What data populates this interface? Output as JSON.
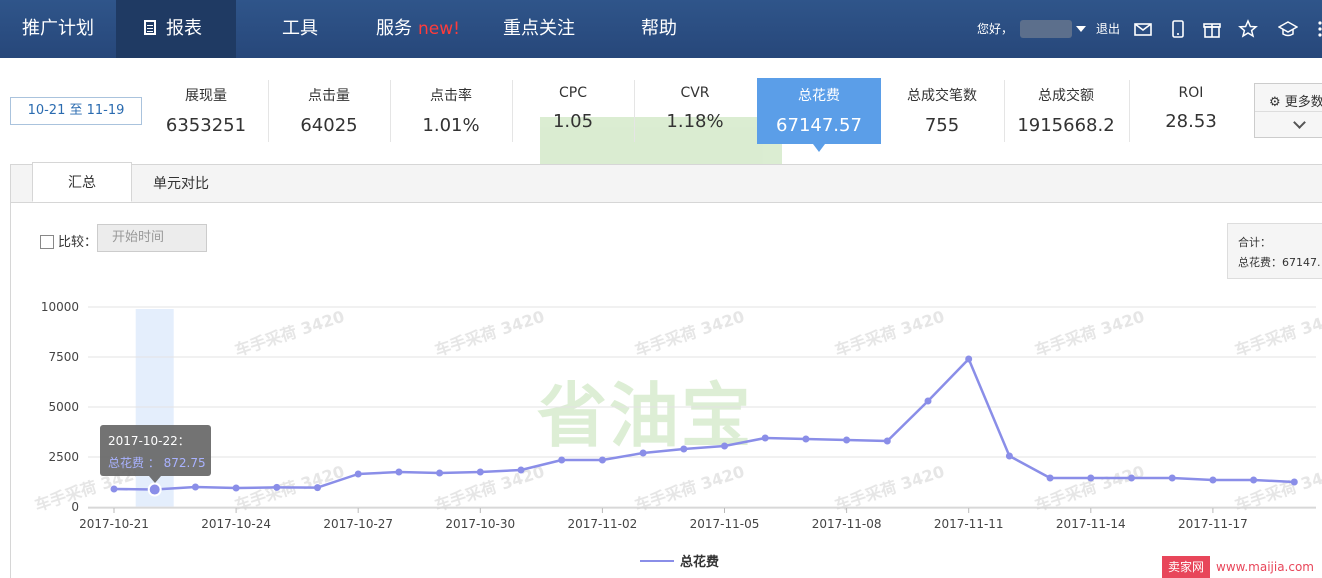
{
  "nav": {
    "items": [
      {
        "label": "推广计划"
      },
      {
        "label": "报表"
      },
      {
        "label": "工具"
      },
      {
        "label": "服务",
        "badge": "new!"
      },
      {
        "label": "重点关注"
      },
      {
        "label": "帮助"
      }
    ],
    "greeting": "您好，",
    "logout": "退出",
    "icons": [
      "mail-icon",
      "phone-icon",
      "gift-icon",
      "star-icon",
      "graduation-cap-icon",
      "more-icon"
    ]
  },
  "date_range": "10-21 至 11-19",
  "metrics": [
    {
      "label": "展现量",
      "value": "6353251"
    },
    {
      "label": "点击量",
      "value": "64025"
    },
    {
      "label": "点击率",
      "value": "1.01%"
    },
    {
      "label": "CPC",
      "value": "1.05"
    },
    {
      "label": "CVR",
      "value": "1.18%"
    },
    {
      "label": "总花费",
      "value": "67147.57",
      "active": true
    },
    {
      "label": "总成交笔数",
      "value": "755"
    },
    {
      "label": "总成交额",
      "value": "1915668.2"
    },
    {
      "label": "ROI",
      "value": "28.53"
    }
  ],
  "more_button": "更多数",
  "tabs": [
    {
      "label": "汇总"
    },
    {
      "label": "单元对比"
    }
  ],
  "compare": {
    "label": "比较：",
    "placeholder": "开始时间"
  },
  "summary": {
    "title": "合计：",
    "line": "总花费：67147."
  },
  "watermark": {
    "brand": "省油宝",
    "repeat_text": "车手采荷 3420"
  },
  "tooltip": {
    "date": "2017-10-22：",
    "text": "总花费 ： 872.75"
  },
  "legend": "总花费",
  "corner": {
    "badge": "卖家网",
    "url": "www.maijia.com"
  },
  "colors": {
    "nav_bg": "#2b4d7e",
    "accent": "#5b9ee8",
    "series": "#8a8ee8",
    "new_badge": "#ff3b3b"
  },
  "chart_data": {
    "type": "line",
    "ylim": [
      0,
      10000
    ],
    "yticks": [
      "0",
      "2500",
      "5000",
      "7500",
      "10000"
    ],
    "xtick_labels": [
      "2017-10-21",
      "2017-10-24",
      "2017-10-27",
      "2017-10-30",
      "2017-11-02",
      "2017-11-05",
      "2017-11-08",
      "2017-11-11",
      "2017-11-14",
      "2017-11-17"
    ],
    "x": [
      "2017-10-21",
      "2017-10-22",
      "2017-10-23",
      "2017-10-24",
      "2017-10-25",
      "2017-10-26",
      "2017-10-27",
      "2017-10-28",
      "2017-10-29",
      "2017-10-30",
      "2017-10-31",
      "2017-11-01",
      "2017-11-02",
      "2017-11-03",
      "2017-11-04",
      "2017-11-05",
      "2017-11-06",
      "2017-11-07",
      "2017-11-08",
      "2017-11-09",
      "2017-11-10",
      "2017-11-11",
      "2017-11-12",
      "2017-11-13",
      "2017-11-14",
      "2017-11-15",
      "2017-11-16",
      "2017-11-17",
      "2017-11-18",
      "2017-11-19"
    ],
    "series": [
      {
        "name": "总花费",
        "values": [
          900,
          872.75,
          1000,
          950,
          980,
          970,
          1650,
          1750,
          1700,
          1750,
          1850,
          2350,
          2350,
          2700,
          2900,
          3050,
          3450,
          3400,
          3350,
          3300,
          5300,
          7400,
          2550,
          1450,
          1450,
          1450,
          1450,
          1350,
          1350,
          1250
        ]
      }
    ],
    "highlight_index": 1,
    "grid": true
  }
}
